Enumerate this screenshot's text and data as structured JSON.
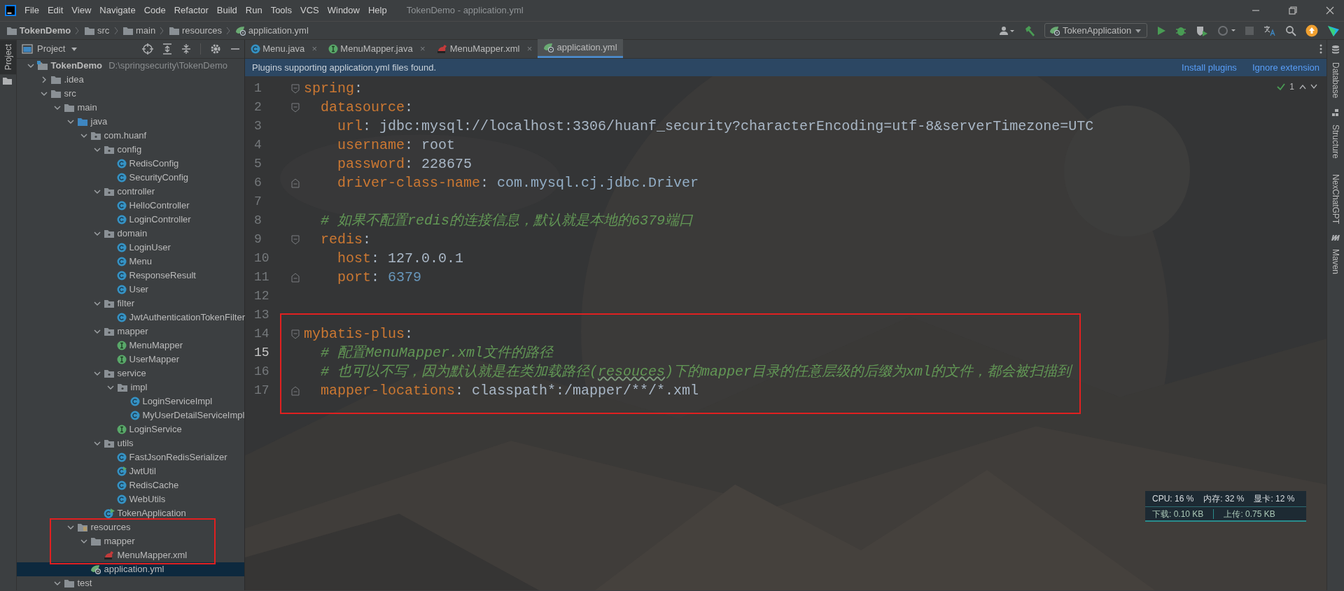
{
  "title_bar": {
    "menu": [
      "File",
      "Edit",
      "View",
      "Navigate",
      "Code",
      "Refactor",
      "Build",
      "Run",
      "Tools",
      "VCS",
      "Window",
      "Help"
    ],
    "title": "TokenDemo - application.yml"
  },
  "breadcrumbs": [
    {
      "label": "TokenDemo",
      "kind": "folder"
    },
    {
      "label": "src",
      "kind": "folder"
    },
    {
      "label": "main",
      "kind": "folder"
    },
    {
      "label": "resources",
      "kind": "folder"
    },
    {
      "label": "application.yml",
      "kind": "yaml"
    }
  ],
  "toolbar": {
    "run_config": "TokenApplication",
    "stop_disabled": true
  },
  "left_stripe": [
    {
      "label": "Project",
      "selected": true
    }
  ],
  "project_panel": {
    "title": "Project",
    "tree": [
      {
        "label": "TokenDemo",
        "path": "D:\\springsecurity\\TokenDemo",
        "kind": "module",
        "expanded": true,
        "selected": false,
        "highlighted": false,
        "children": [
          {
            "label": ".idea",
            "kind": "folder",
            "expanded": false,
            "selected": false,
            "highlighted": false
          },
          {
            "label": "src",
            "kind": "folder",
            "expanded": true,
            "selected": false,
            "highlighted": false,
            "children": [
              {
                "label": "main",
                "kind": "folder",
                "expanded": true,
                "selected": false,
                "highlighted": false,
                "children": [
                  {
                    "label": "java",
                    "kind": "source",
                    "expanded": true,
                    "selected": false,
                    "highlighted": false,
                    "children": [
                      {
                        "label": "com.huanf",
                        "kind": "package",
                        "expanded": true,
                        "selected": false,
                        "highlighted": false,
                        "children": [
                          {
                            "label": "config",
                            "kind": "package",
                            "expanded": true,
                            "selected": false,
                            "highlighted": false,
                            "children": [
                              {
                                "label": "RedisConfig",
                                "kind": "class",
                                "selected": false,
                                "highlighted": false
                              },
                              {
                                "label": "SecurityConfig",
                                "kind": "class",
                                "selected": false,
                                "highlighted": false
                              }
                            ]
                          },
                          {
                            "label": "controller",
                            "kind": "package",
                            "expanded": true,
                            "selected": false,
                            "highlighted": false,
                            "children": [
                              {
                                "label": "HelloController",
                                "kind": "class",
                                "selected": false,
                                "highlighted": false
                              },
                              {
                                "label": "LoginController",
                                "kind": "class",
                                "selected": false,
                                "highlighted": false
                              }
                            ]
                          },
                          {
                            "label": "domain",
                            "kind": "package",
                            "expanded": true,
                            "selected": false,
                            "highlighted": false,
                            "children": [
                              {
                                "label": "LoginUser",
                                "kind": "class",
                                "selected": false,
                                "highlighted": false
                              },
                              {
                                "label": "Menu",
                                "kind": "class",
                                "selected": false,
                                "highlighted": false
                              },
                              {
                                "label": "ResponseResult",
                                "kind": "class",
                                "selected": false,
                                "highlighted": false
                              },
                              {
                                "label": "User",
                                "kind": "class",
                                "selected": false,
                                "highlighted": false
                              }
                            ]
                          },
                          {
                            "label": "filter",
                            "kind": "package",
                            "expanded": true,
                            "selected": false,
                            "highlighted": false,
                            "children": [
                              {
                                "label": "JwtAuthenticationTokenFilter",
                                "kind": "class",
                                "selected": false,
                                "highlighted": false
                              }
                            ]
                          },
                          {
                            "label": "mapper",
                            "kind": "package",
                            "expanded": true,
                            "selected": false,
                            "highlighted": false,
                            "children": [
                              {
                                "label": "MenuMapper",
                                "kind": "interface",
                                "selected": false,
                                "highlighted": false
                              },
                              {
                                "label": "UserMapper",
                                "kind": "interface",
                                "selected": false,
                                "highlighted": false
                              }
                            ]
                          },
                          {
                            "label": "service",
                            "kind": "package",
                            "expanded": true,
                            "selected": false,
                            "highlighted": false,
                            "children": [
                              {
                                "label": "impl",
                                "kind": "package",
                                "expanded": true,
                                "selected": false,
                                "highlighted": false,
                                "children": [
                                  {
                                    "label": "LoginServiceImpl",
                                    "kind": "class",
                                    "selected": false,
                                    "highlighted": false
                                  },
                                  {
                                    "label": "MyUserDetailServiceImpl",
                                    "kind": "class",
                                    "selected": false,
                                    "highlighted": false
                                  }
                                ]
                              },
                              {
                                "label": "LoginService",
                                "kind": "interface",
                                "selected": false,
                                "highlighted": false
                              }
                            ]
                          },
                          {
                            "label": "utils",
                            "kind": "package",
                            "expanded": true,
                            "selected": false,
                            "highlighted": false,
                            "children": [
                              {
                                "label": "FastJsonRedisSerializer",
                                "kind": "class",
                                "selected": false,
                                "highlighted": false
                              },
                              {
                                "label": "JwtUtil",
                                "kind": "runnable",
                                "selected": false,
                                "highlighted": false
                              },
                              {
                                "label": "RedisCache",
                                "kind": "class",
                                "selected": false,
                                "highlighted": false
                              },
                              {
                                "label": "WebUtils",
                                "kind": "class",
                                "selected": false,
                                "highlighted": false
                              }
                            ]
                          },
                          {
                            "label": "TokenApplication",
                            "kind": "spring",
                            "selected": false,
                            "highlighted": false
                          }
                        ]
                      }
                    ]
                  },
                  {
                    "label": "resources",
                    "kind": "resources",
                    "expanded": true,
                    "selected": false,
                    "highlighted": true,
                    "children": [
                      {
                        "label": "mapper",
                        "kind": "folder",
                        "expanded": true,
                        "selected": false,
                        "highlighted": true,
                        "children": [
                          {
                            "label": "MenuMapper.xml",
                            "kind": "xml",
                            "selected": false,
                            "highlighted": true
                          }
                        ]
                      },
                      {
                        "label": "application.yml",
                        "kind": "yaml",
                        "selected": true,
                        "highlighted": false
                      }
                    ]
                  }
                ]
              },
              {
                "label": "test",
                "kind": "folder",
                "expanded": true,
                "selected": false,
                "highlighted": false
              }
            ]
          }
        ]
      }
    ]
  },
  "editor_tabs": [
    {
      "label": "Menu.java",
      "kind": "class",
      "selected": false,
      "close": "×"
    },
    {
      "label": "MenuMapper.java",
      "kind": "interface",
      "selected": false,
      "close": "×"
    },
    {
      "label": "MenuMapper.xml",
      "kind": "xml",
      "selected": false,
      "close": "×"
    },
    {
      "label": "application.yml",
      "kind": "yaml",
      "selected": true
    }
  ],
  "notification": {
    "message": "Plugins supporting application.yml files found.",
    "actions": [
      "Install plugins",
      "Ignore extension"
    ]
  },
  "inspection": {
    "count": "1"
  },
  "code_lines": [
    {
      "number": "1",
      "current": false,
      "kind": "opening",
      "segments": [
        {
          "kind": "key",
          "text": "spring"
        },
        {
          "kind": "plain",
          "text": ":"
        }
      ]
    },
    {
      "number": "2",
      "current": false,
      "kind": "opening",
      "segments": [
        {
          "kind": "key",
          "text": "  datasource"
        },
        {
          "kind": "plain",
          "text": ":"
        }
      ]
    },
    {
      "number": "3",
      "current": false,
      "kind": "plain",
      "segments": [
        {
          "kind": "key",
          "text": "    url"
        },
        {
          "kind": "plain",
          "text": ": jdbc:mysql://localhost:3306/huanf_security?characterEncoding=utf-8&serverTimezone=UTC"
        }
      ]
    },
    {
      "number": "4",
      "current": false,
      "kind": "plain",
      "segments": [
        {
          "kind": "key",
          "text": "    username"
        },
        {
          "kind": "plain",
          "text": ": root"
        }
      ]
    },
    {
      "number": "5",
      "current": false,
      "kind": "plain",
      "segments": [
        {
          "kind": "key",
          "text": "    password"
        },
        {
          "kind": "plain",
          "text": ": 228675"
        }
      ]
    },
    {
      "number": "6",
      "current": false,
      "kind": "closing",
      "segments": [
        {
          "kind": "key",
          "text": "    driver-class-name"
        },
        {
          "kind": "plain",
          "text": ": "
        },
        {
          "kind": "reference",
          "text": "com.mysql.cj.jdbc.Driver"
        }
      ]
    },
    {
      "number": "7",
      "current": false,
      "kind": "plain"
    },
    {
      "number": "8",
      "current": false,
      "kind": "plain",
      "segments": [
        {
          "kind": "comment",
          "text": "  # 如果不配置redis的连接信息，默认就是本地的6379端口"
        }
      ]
    },
    {
      "number": "9",
      "current": false,
      "kind": "opening",
      "segments": [
        {
          "kind": "key",
          "text": "  redis"
        },
        {
          "kind": "plain",
          "text": ":"
        }
      ]
    },
    {
      "number": "10",
      "current": false,
      "kind": "plain",
      "segments": [
        {
          "kind": "key",
          "text": "    host"
        },
        {
          "kind": "plain",
          "text": ": 127.0.0.1"
        }
      ]
    },
    {
      "number": "11",
      "current": false,
      "kind": "closing",
      "segments": [
        {
          "kind": "key",
          "text": "    port"
        },
        {
          "kind": "plain",
          "text": ": "
        },
        {
          "kind": "number",
          "text": "6379"
        }
      ]
    },
    {
      "number": "12",
      "current": false,
      "kind": "plain"
    },
    {
      "number": "13",
      "current": false,
      "kind": "plain"
    }
  ],
  "highlighted_code_lines": [
    {
      "number": "14",
      "current": false,
      "kind": "opening",
      "segments": [
        {
          "kind": "key",
          "text": "mybatis-plus"
        },
        {
          "kind": "plain",
          "text": ":"
        }
      ]
    },
    {
      "number": "15",
      "current": true,
      "kind": "plain",
      "segments": [
        {
          "kind": "comment",
          "text": "  # 配置MenuMapper.xml文件的路径"
        }
      ]
    },
    {
      "number": "16",
      "current": false,
      "kind": "plain",
      "segments": [
        {
          "kind": "comment",
          "text": "  # 也可以不写，因为默认就是在类加载路径("
        },
        {
          "kind": "typo",
          "text": "resouces"
        },
        {
          "kind": "comment",
          "text": ")下的mapper目录的任意层级的后缀为xml的文件，都会被扫描到"
        }
      ]
    },
    {
      "number": "17",
      "current": false,
      "kind": "closing",
      "segments": [
        {
          "kind": "key",
          "text": "  mapper-locations"
        },
        {
          "kind": "plain",
          "text": ": classpath*:/mapper/**/*.xml"
        }
      ]
    }
  ],
  "right_stripe": [
    {
      "label": "Database",
      "kind": "database"
    },
    {
      "label": "Structure",
      "kind": "structure"
    },
    {
      "label": "NexChatGPT",
      "kind": "plain"
    },
    {
      "label": "Maven",
      "kind": "maven"
    }
  ],
  "system_monitor": {
    "top": [
      "CPU: 16 %",
      "内存: 32 %",
      "显卡: 12 %"
    ],
    "bottom": [
      "下载: 0.10 KB",
      "上传: 0.75 KB"
    ]
  }
}
